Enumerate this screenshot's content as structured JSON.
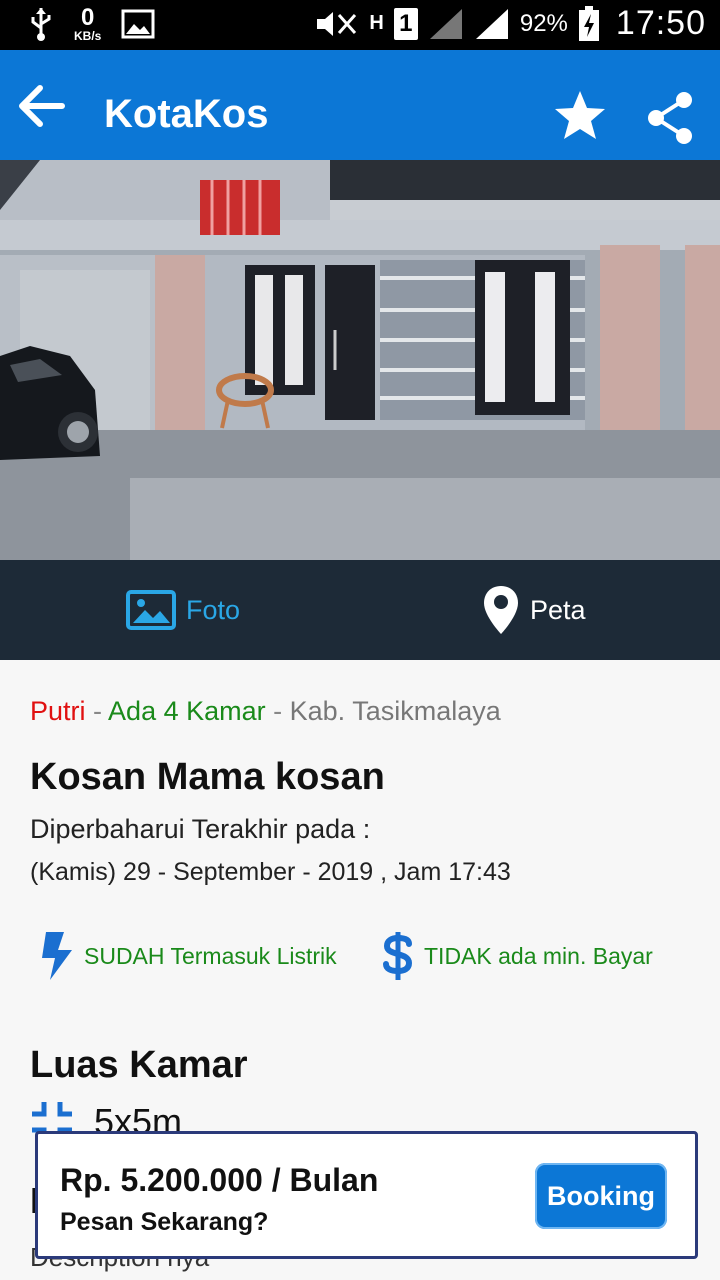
{
  "status_bar": {
    "net_speed_value": "0",
    "net_speed_unit": "KB/s",
    "network_type": "H",
    "sim_slot": "1",
    "battery_percent": "92%",
    "time": "17:50",
    "icons": [
      "usb-icon",
      "image-icon",
      "mute-icon",
      "signal-icon",
      "battery-charging-icon"
    ]
  },
  "app_bar": {
    "title": "KotaKos",
    "icons": [
      "back-arrow-icon",
      "star-icon",
      "share-icon"
    ]
  },
  "media_tabs": [
    {
      "label": "Foto",
      "icon": "photo-icon",
      "active": true
    },
    {
      "label": "Peta",
      "icon": "map-pin-icon",
      "active": false
    }
  ],
  "listing": {
    "gender": "Putri",
    "separator": " - ",
    "rooms": "Ada 4 Kamar",
    "location": "Kab. Tasikmalaya",
    "title": "Kosan Mama kosan",
    "updated_label": "Diperbaharui Terakhir pada :",
    "updated_date": "(Kamis) 29 - September - 2019 , Jam 17:43"
  },
  "features": [
    {
      "label": "SUDAH Termasuk Listrik",
      "icon": "lightning-icon"
    },
    {
      "label": "TIDAK ada min. Bayar",
      "icon": "dollar-icon"
    }
  ],
  "room_size": {
    "section_title": "Luas Kamar",
    "value": "5x5m",
    "icon": "expand-icon"
  },
  "description_partial": "Description nya",
  "price_card": {
    "price": "Rp. 5.200.000 / Bulan",
    "cta_question": "Pesan Sekarang?",
    "booking_label": "Booking"
  },
  "colors": {
    "primary": "#0c77d6",
    "tab_bar": "#1d2a37",
    "active_tab": "#2aa7e6",
    "gender": "#e01010",
    "green": "#1a8a1a",
    "card_border": "#2b3a7a"
  }
}
